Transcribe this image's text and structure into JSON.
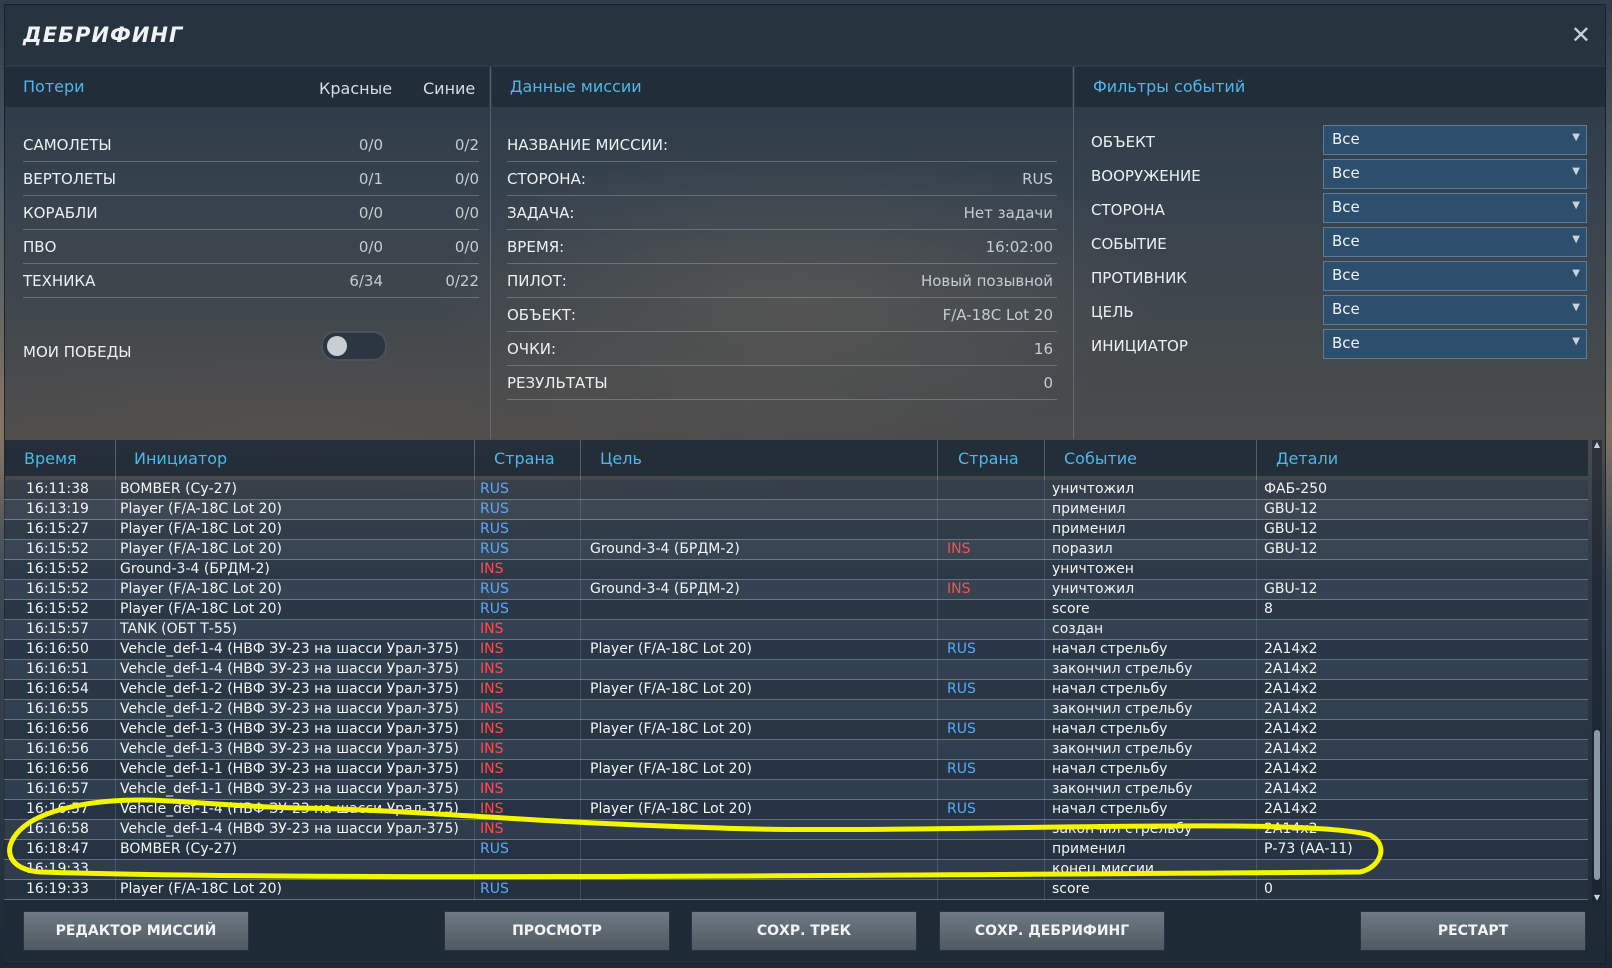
{
  "window": {
    "title": "ДЕБРИФИНГ",
    "close_glyph": "✕"
  },
  "losses": {
    "title": "Потери",
    "col_red": "Красные",
    "col_blue": "Синие",
    "rows": [
      {
        "label": "САМОЛЕТЫ",
        "red": "0/0",
        "blue": "0/2"
      },
      {
        "label": "ВЕРТОЛЕТЫ",
        "red": "0/1",
        "blue": "0/0"
      },
      {
        "label": "КОРАБЛИ",
        "red": "0/0",
        "blue": "0/0"
      },
      {
        "label": "ПВО",
        "red": "0/0",
        "blue": "0/0"
      },
      {
        "label": "ТЕХНИКА",
        "red": "6/34",
        "blue": "0/22"
      }
    ],
    "my_wins_label": "МОИ ПОБЕДЫ"
  },
  "mission": {
    "title": "Данные миссии",
    "rows": [
      {
        "label": "НАЗВАНИЕ МИССИИ:",
        "value": ""
      },
      {
        "label": "СТОРОНА:",
        "value": "RUS"
      },
      {
        "label": "ЗАДАЧА:",
        "value": "Нет задачи"
      },
      {
        "label": "ВРЕМЯ:",
        "value": "16:02:00"
      },
      {
        "label": "ПИЛОТ:",
        "value": "Новый позывной"
      },
      {
        "label": "ОБЪЕКТ:",
        "value": "F/A-18C Lot 20"
      },
      {
        "label": "ОЧКИ:",
        "value": "16"
      },
      {
        "label": "РЕЗУЛЬТАТЫ",
        "value": "0"
      }
    ]
  },
  "filters": {
    "title": "Фильтры событий",
    "rows": [
      {
        "label": "ОБЪЕКТ",
        "value": "Все"
      },
      {
        "label": "ВООРУЖЕНИЕ",
        "value": "Все"
      },
      {
        "label": "СТОРОНА",
        "value": "Все"
      },
      {
        "label": "СОБЫТИЕ",
        "value": "Все"
      },
      {
        "label": "ПРОТИВНИК",
        "value": "Все"
      },
      {
        "label": "ЦЕЛЬ",
        "value": "Все"
      },
      {
        "label": "ИНИЦИАТОР",
        "value": "Все"
      }
    ]
  },
  "events": {
    "headers": {
      "time": "Время",
      "initiator": "Инициатор",
      "country1": "Страна",
      "target": "Цель",
      "country2": "Страна",
      "event": "Событие",
      "details": "Детали"
    },
    "rows": [
      {
        "time": "16:11:38",
        "initiator": "BOMBER (Су-27)",
        "c1": "RUS",
        "target": "",
        "c2": "",
        "event": "уничтожил",
        "details": "ФАБ-250"
      },
      {
        "time": "16:13:19",
        "initiator": "Player (F/A-18C Lot 20)",
        "c1": "RUS",
        "target": "",
        "c2": "",
        "event": "применил",
        "details": "GBU-12"
      },
      {
        "time": "16:15:27",
        "initiator": "Player (F/A-18C Lot 20)",
        "c1": "RUS",
        "target": "",
        "c2": "",
        "event": "применил",
        "details": "GBU-12"
      },
      {
        "time": "16:15:52",
        "initiator": "Player (F/A-18C Lot 20)",
        "c1": "RUS",
        "target": "Ground-3-4 (БРДМ-2)",
        "c2": "INS",
        "event": "поразил",
        "details": "GBU-12"
      },
      {
        "time": "16:15:52",
        "initiator": "Ground-3-4 (БРДМ-2)",
        "c1": "INS",
        "target": "",
        "c2": "",
        "event": "уничтожен",
        "details": ""
      },
      {
        "time": "16:15:52",
        "initiator": "Player (F/A-18C Lot 20)",
        "c1": "RUS",
        "target": "Ground-3-4 (БРДМ-2)",
        "c2": "INS",
        "event": "уничтожил",
        "details": "GBU-12"
      },
      {
        "time": "16:15:52",
        "initiator": "Player (F/A-18C Lot 20)",
        "c1": "RUS",
        "target": "",
        "c2": "",
        "event": "score",
        "details": "8"
      },
      {
        "time": "16:15:57",
        "initiator": "TANK (ОБТ Т-55)",
        "c1": "INS",
        "target": "",
        "c2": "",
        "event": "создан",
        "details": ""
      },
      {
        "time": "16:16:50",
        "initiator": "Vehcle_def-1-4 (НВФ ЗУ-23 на шасси Урал-375)",
        "c1": "INS",
        "target": "Player (F/A-18C Lot 20)",
        "c2": "RUS",
        "event": "начал стрельбу",
        "details": "2A14x2"
      },
      {
        "time": "16:16:51",
        "initiator": "Vehcle_def-1-4 (НВФ ЗУ-23 на шасси Урал-375)",
        "c1": "INS",
        "target": "",
        "c2": "",
        "event": "закончил стрельбу",
        "details": "2A14x2"
      },
      {
        "time": "16:16:54",
        "initiator": "Vehcle_def-1-2 (НВФ ЗУ-23 на шасси Урал-375)",
        "c1": "INS",
        "target": "Player (F/A-18C Lot 20)",
        "c2": "RUS",
        "event": "начал стрельбу",
        "details": "2A14x2"
      },
      {
        "time": "16:16:55",
        "initiator": "Vehcle_def-1-2 (НВФ ЗУ-23 на шасси Урал-375)",
        "c1": "INS",
        "target": "",
        "c2": "",
        "event": "закончил стрельбу",
        "details": "2A14x2"
      },
      {
        "time": "16:16:56",
        "initiator": "Vehcle_def-1-3 (НВФ ЗУ-23 на шасси Урал-375)",
        "c1": "INS",
        "target": "Player (F/A-18C Lot 20)",
        "c2": "RUS",
        "event": "начал стрельбу",
        "details": "2A14x2"
      },
      {
        "time": "16:16:56",
        "initiator": "Vehcle_def-1-3 (НВФ ЗУ-23 на шасси Урал-375)",
        "c1": "INS",
        "target": "",
        "c2": "",
        "event": "закончил стрельбу",
        "details": "2A14x2"
      },
      {
        "time": "16:16:56",
        "initiator": "Vehcle_def-1-1 (НВФ ЗУ-23 на шасси Урал-375)",
        "c1": "INS",
        "target": "Player (F/A-18C Lot 20)",
        "c2": "RUS",
        "event": "начал стрельбу",
        "details": "2A14x2"
      },
      {
        "time": "16:16:57",
        "initiator": "Vehcle_def-1-1 (НВФ ЗУ-23 на шасси Урал-375)",
        "c1": "INS",
        "target": "",
        "c2": "",
        "event": "закончил стрельбу",
        "details": "2A14x2"
      },
      {
        "time": "16:16:57",
        "initiator": "Vehcle_def-1-4 (НВФ ЗУ-23 на шасси Урал-375)",
        "c1": "INS",
        "target": "Player (F/A-18C Lot 20)",
        "c2": "RUS",
        "event": "начал стрельбу",
        "details": "2A14x2"
      },
      {
        "time": "16:16:58",
        "initiator": "Vehcle_def-1-4 (НВФ ЗУ-23 на шасси Урал-375)",
        "c1": "INS",
        "target": "",
        "c2": "",
        "event": "закончил стрельбу",
        "details": "2A14x2"
      },
      {
        "time": "16:18:47",
        "initiator": "BOMBER (Су-27)",
        "c1": "RUS",
        "target": "",
        "c2": "",
        "event": "применил",
        "details": "Р-73 (АА-11)"
      },
      {
        "time": "16:19:33",
        "initiator": "",
        "c1": "",
        "target": "",
        "c2": "",
        "event": "конец миссии",
        "details": ""
      },
      {
        "time": "16:19:33",
        "initiator": "Player (F/A-18C Lot 20)",
        "c1": "RUS",
        "target": "",
        "c2": "",
        "event": "score",
        "details": "0"
      }
    ]
  },
  "buttons": {
    "editor": "РЕДАКТОР МИССИЙ",
    "view": "ПРОСМОТР",
    "save_track": "СОХР. ТРЕК",
    "save_debrief": "СОХР. ДЕБРИФИНГ",
    "restart": "РЕСТАРТ"
  },
  "colors": {
    "accent": "#4fb6ea",
    "country_blue": "#5aa8ff",
    "country_red": "#ff4d4d",
    "highlight": "#f5f500"
  }
}
